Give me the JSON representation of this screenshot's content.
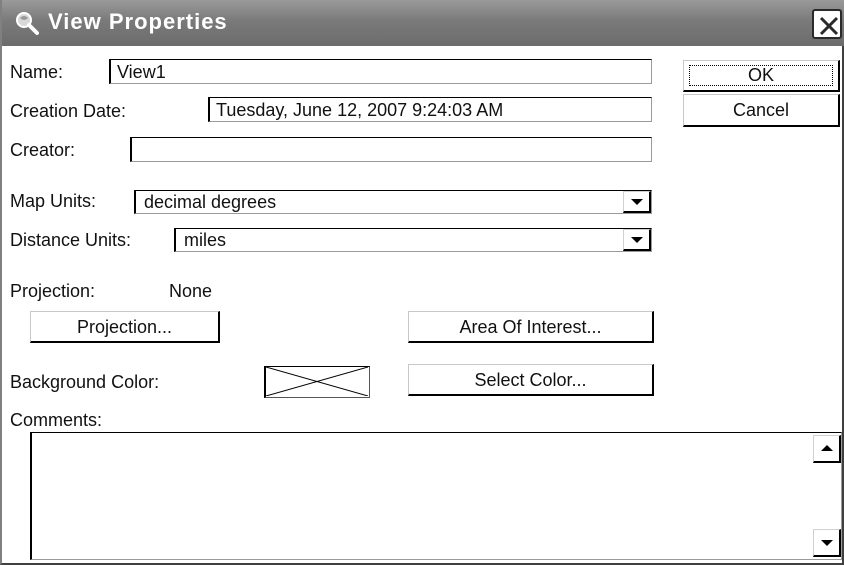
{
  "window": {
    "title": "View Properties"
  },
  "fields": {
    "name": {
      "label": "Name:",
      "value": "View1"
    },
    "creation_date": {
      "label": "Creation Date:",
      "value": "Tuesday, June 12, 2007 9:24:03 AM"
    },
    "creator": {
      "label": "Creator:",
      "value": ""
    },
    "map_units": {
      "label": "Map Units:",
      "value": "decimal degrees"
    },
    "distance_units": {
      "label": "Distance Units:",
      "value": "miles"
    },
    "projection": {
      "label": "Projection:",
      "value": "None"
    },
    "background_color": {
      "label": "Background Color:"
    },
    "comments": {
      "label": "Comments:",
      "value": ""
    }
  },
  "buttons": {
    "ok": "OK",
    "cancel": "Cancel",
    "projection": "Projection...",
    "area_of_interest": "Area Of Interest...",
    "select_color": "Select Color..."
  },
  "icons": {
    "title": "magnifier-globe-icon",
    "close": "close-icon",
    "dropdown": "chevron-down-icon",
    "scroll_up": "scroll-up-icon",
    "scroll_down": "scroll-down-icon"
  }
}
